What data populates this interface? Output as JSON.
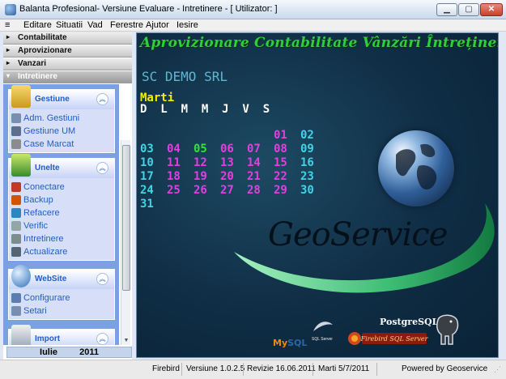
{
  "window": {
    "title": "Balanta Profesional- Versiune Evaluare - Intretinere - [ Utilizator: ]",
    "buttons": {
      "minimize": "▁",
      "maximize": "▢",
      "close": "✕"
    }
  },
  "menu": {
    "items": [
      "Editare",
      "Situatii",
      "Vad",
      "Ferestre",
      "Ajutor",
      "Iesire"
    ]
  },
  "nav_groups": [
    {
      "label": "Contabilitate",
      "arrow": "▸"
    },
    {
      "label": "Aprovizionare",
      "arrow": "▸"
    },
    {
      "label": "Vanzari",
      "arrow": "▸"
    },
    {
      "label": "Intretinere",
      "arrow": "▾"
    }
  ],
  "taskpane": {
    "groups": [
      {
        "title": "Gestiune",
        "toggle": "︽",
        "icon": "folder-icon",
        "items": [
          "Adm. Gestiuni",
          "Gestiune UM",
          "Case Marcat"
        ]
      },
      {
        "title": "Unelte",
        "toggle": "︽",
        "icon": "tools-icon",
        "items": [
          "Conectare",
          "Backup",
          "Refacere",
          "Verific",
          "Intretinere",
          "Actualizare"
        ]
      },
      {
        "title": "WebSite",
        "toggle": "︽",
        "icon": "globe-icon",
        "items": [
          "Configurare",
          "Setari"
        ]
      },
      {
        "title": "Import",
        "toggle": "︽",
        "icon": "import-icon",
        "items": []
      }
    ]
  },
  "month_bar": {
    "month": "Iulie",
    "year": "2011"
  },
  "main": {
    "banner": "Aprovizionare Contabilitate  Vânzări  Întreținere",
    "company": "SC DEMO SRL",
    "dayname": "Marti",
    "weekdays": "D  L  M  M  J  V  S",
    "logo_text": "GeoService",
    "calendar": {
      "rows": [
        [
          null,
          null,
          null,
          null,
          null,
          {
            "d": "01",
            "c": "#e040e0"
          },
          {
            "d": "02",
            "c": "#3fd4e6"
          }
        ],
        [
          {
            "d": "03",
            "c": "#3fd4e6"
          },
          {
            "d": "04",
            "c": "#e040e0"
          },
          {
            "d": "05",
            "c": "#36e036"
          },
          {
            "d": "06",
            "c": "#e040e0"
          },
          {
            "d": "07",
            "c": "#e040e0"
          },
          {
            "d": "08",
            "c": "#e040e0"
          },
          {
            "d": "09",
            "c": "#3fd4e6"
          }
        ],
        [
          {
            "d": "10",
            "c": "#3fd4e6"
          },
          {
            "d": "11",
            "c": "#e040e0"
          },
          {
            "d": "12",
            "c": "#e040e0"
          },
          {
            "d": "13",
            "c": "#e040e0"
          },
          {
            "d": "14",
            "c": "#e040e0"
          },
          {
            "d": "15",
            "c": "#e040e0"
          },
          {
            "d": "16",
            "c": "#3fd4e6"
          }
        ],
        [
          {
            "d": "17",
            "c": "#3fd4e6"
          },
          {
            "d": "18",
            "c": "#e040e0"
          },
          {
            "d": "19",
            "c": "#e040e0"
          },
          {
            "d": "20",
            "c": "#e040e0"
          },
          {
            "d": "21",
            "c": "#e040e0"
          },
          {
            "d": "22",
            "c": "#e040e0"
          },
          {
            "d": "23",
            "c": "#3fd4e6"
          }
        ],
        [
          {
            "d": "24",
            "c": "#3fd4e6"
          },
          {
            "d": "25",
            "c": "#e040e0"
          },
          {
            "d": "26",
            "c": "#e040e0"
          },
          {
            "d": "27",
            "c": "#e040e0"
          },
          {
            "d": "28",
            "c": "#e040e0"
          },
          {
            "d": "29",
            "c": "#e040e0"
          },
          {
            "d": "30",
            "c": "#3fd4e6"
          }
        ],
        [
          {
            "d": "31",
            "c": "#3fd4e6"
          },
          null,
          null,
          null,
          null,
          null,
          null
        ]
      ]
    },
    "logos": {
      "postgresql": "PostgreSQL",
      "mysql_my": "My",
      "mysql_sql": "SQL",
      "sqlserver": "SQL Server",
      "firebird": "Firebird SQL Server"
    }
  },
  "status": {
    "db": "Firebird",
    "version": "Versiune 1.0.2.5",
    "revision": "Revizie 16.06.2011",
    "date": "Marti  5/7/2011",
    "powered": "Powered by Geoservice"
  }
}
